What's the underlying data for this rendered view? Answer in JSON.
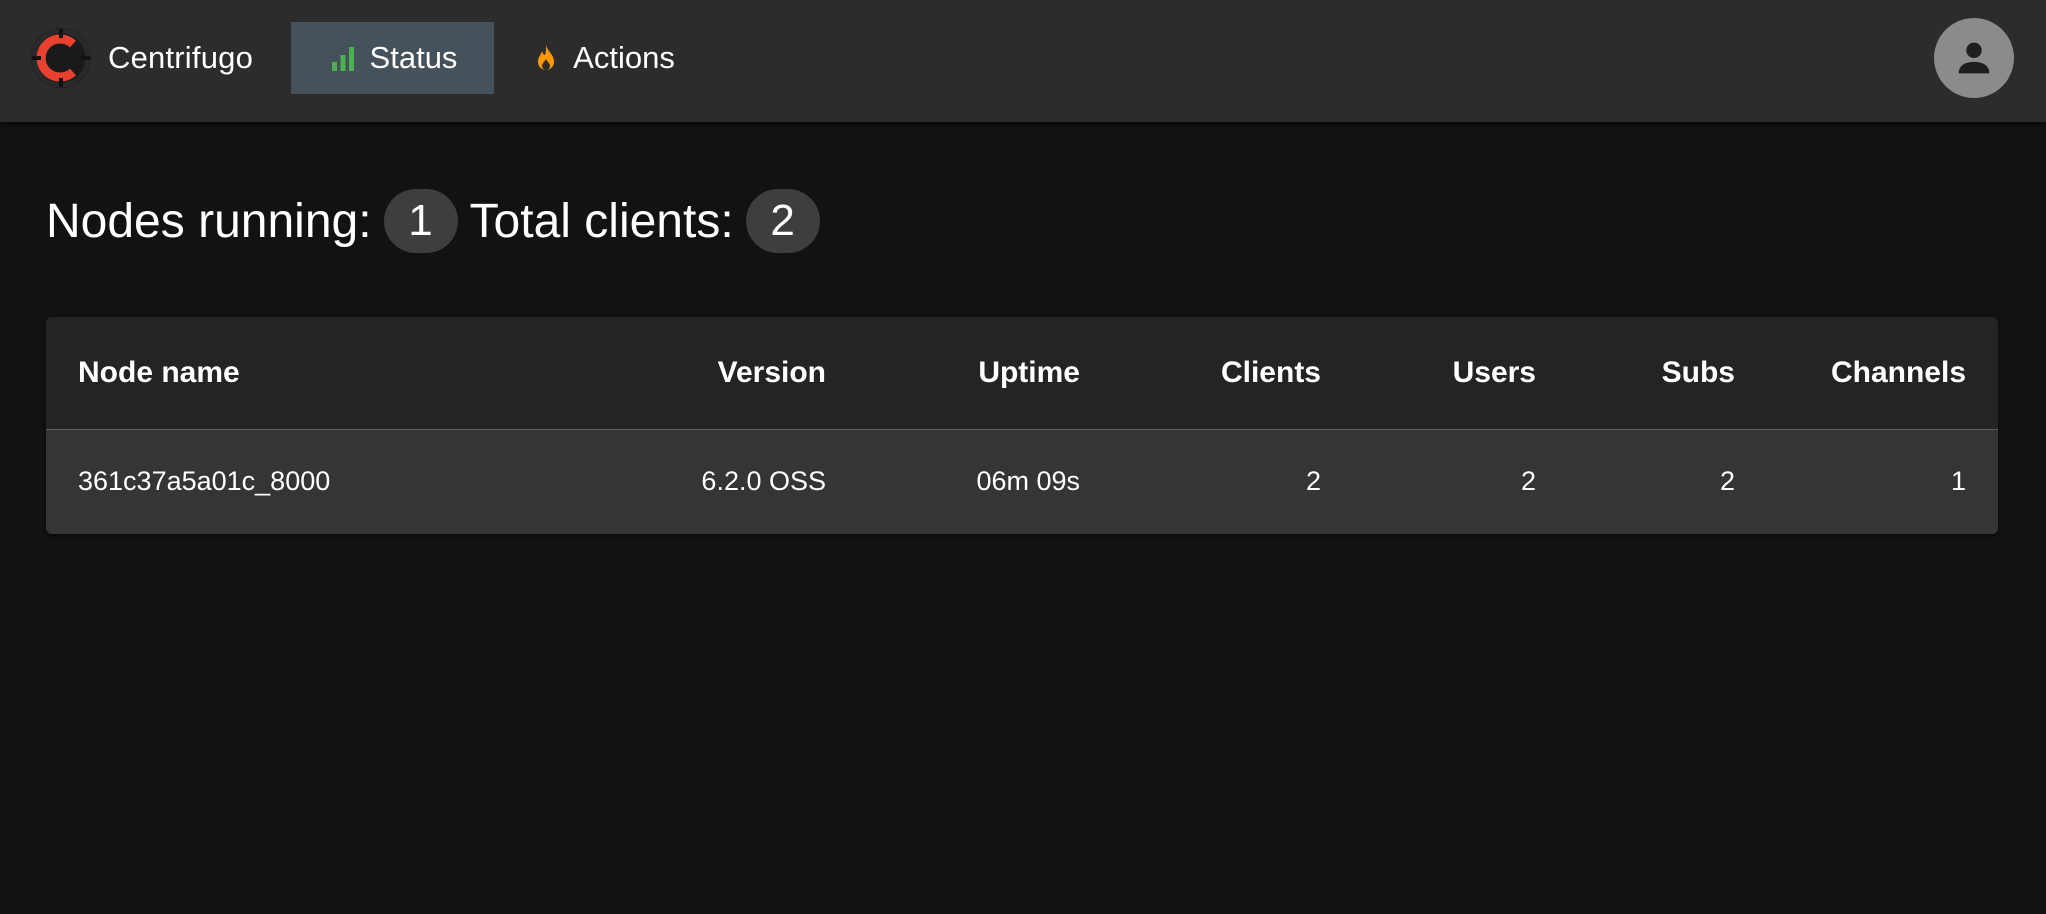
{
  "app": {
    "brand": "Centrifugo",
    "nav": [
      {
        "label": "Status",
        "icon": "bar-chart-icon",
        "active": true
      },
      {
        "label": "Actions",
        "icon": "flame-icon",
        "active": false
      }
    ],
    "account_icon": "account-icon"
  },
  "summary": {
    "nodes_label": "Nodes running:",
    "nodes_value": "1",
    "clients_label": "Total clients:",
    "clients_value": "2"
  },
  "table": {
    "columns": [
      "Node name",
      "Version",
      "Uptime",
      "Clients",
      "Users",
      "Subs",
      "Channels"
    ],
    "rows": [
      [
        "361c37a5a01c_8000",
        "6.2.0 OSS",
        "06m 09s",
        "2",
        "2",
        "2",
        "1"
      ]
    ]
  },
  "colors": {
    "appbar": "#2c2c2c",
    "background": "#121212",
    "active_nav": "#45525c",
    "status_icon": "#4caf50",
    "actions_icon": "#ff9800",
    "logo_red": "#e8412f"
  }
}
